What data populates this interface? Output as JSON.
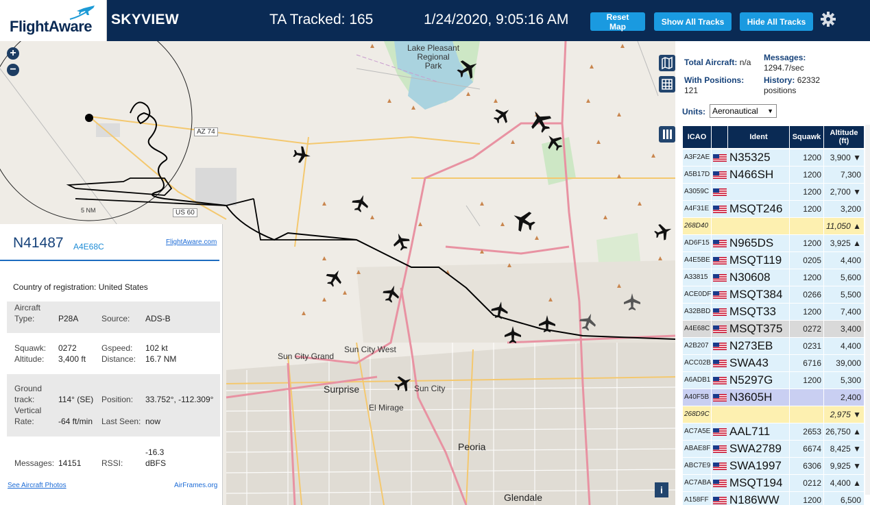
{
  "header": {
    "logo_text": "FlightAware",
    "app_title": "SKYVIEW",
    "tracked": "TA Tracked: 165",
    "timestamp": "1/24/2020, 9:05:16 AM",
    "buttons": {
      "reset": "Reset Map",
      "show_all": "Show All Tracks",
      "hide_all": "Hide All Tracks"
    }
  },
  "map": {
    "zoom_in": "+",
    "zoom_out": "−",
    "info": "i",
    "labels": {
      "lake": "Lake Pleasant Regional Park",
      "lake1": "Lake Pleasant",
      "lake2": "Regional",
      "lake3": "Park",
      "az74": "AZ 74",
      "us60": "US 60",
      "range": "5 NM",
      "sun_city_grand": "Sun City Grand",
      "sun_city_west": "Sun City West",
      "sun_city": "Sun City",
      "surprise": "Surprise",
      "el_mirage": "El Mirage",
      "peoria": "Peoria",
      "glendale": "Glendale"
    }
  },
  "detail": {
    "registration": "N41487",
    "hex": "A4E68C",
    "link": "FlightAware.com",
    "country_label": "Country of registration:",
    "country": "United States",
    "aircraft_type_label1": "Aircraft",
    "aircraft_type_label2": "Type:",
    "aircraft_type": "P28A",
    "source_label": "Source:",
    "source": "ADS-B",
    "squawk_label": "Squawk:",
    "squawk": "0272",
    "gspeed_label": "Gspeed:",
    "gspeed": "102 kt",
    "altitude_label": "Altitude:",
    "altitude": "3,400 ft",
    "distance_label": "Distance:",
    "distance": "16.7 NM",
    "track_label1": "Ground",
    "track_label2": "track:",
    "track": "114° (SE)",
    "position_label": "Position:",
    "position": "33.752°, -112.309°",
    "vrate_label1": "Vertical",
    "vrate_label2": "Rate:",
    "vrate": "-64 ft/min",
    "last_seen_label": "Last Seen:",
    "last_seen": "now",
    "messages_label": "Messages:",
    "messages": "14151",
    "rssi_label": "RSSI:",
    "rssi1": "-16.3",
    "rssi2": "dBFS",
    "photos_link": "See Aircraft Photos",
    "airframes_link": "AirFrames.org"
  },
  "stats": {
    "total_label": "Total Aircraft:",
    "total": "n/a",
    "messages_label": "Messages:",
    "messages": "1294.7/sec",
    "positions_label": "With Positions:",
    "positions": "121",
    "history_label": "History:",
    "history": "62332",
    "history_unit": "positions",
    "units_label": "Units:",
    "units_value": "Aeronautical"
  },
  "table": {
    "headers": {
      "icao": "ICAO",
      "ident": "Ident",
      "squawk": "Squawk",
      "altitude1": "Altitude",
      "altitude2": "(ft)"
    },
    "rows": [
      {
        "icao": "A3F2AE",
        "ident": "N35325",
        "squawk": "1200",
        "alt": "3,900 ▼"
      },
      {
        "icao": "A5B17D",
        "ident": "N466SH",
        "squawk": "1200",
        "alt": "7,300"
      },
      {
        "icao": "A3059C",
        "ident": "",
        "squawk": "1200",
        "alt": "2,700 ▼"
      },
      {
        "icao": "A4F31E",
        "ident": "MSQT246",
        "squawk": "1200",
        "alt": "3,200"
      },
      {
        "icao": "268D40",
        "ident": "",
        "squawk": "",
        "alt": "11,050 ▲"
      },
      {
        "icao": "AD6F15",
        "ident": "N965DS",
        "squawk": "1200",
        "alt": "3,925 ▲"
      },
      {
        "icao": "A4E5BE",
        "ident": "MSQT119",
        "squawk": "0205",
        "alt": "4,400"
      },
      {
        "icao": "A33815",
        "ident": "N30608",
        "squawk": "1200",
        "alt": "5,600"
      },
      {
        "icao": "ACE0DF",
        "ident": "MSQT384",
        "squawk": "0266",
        "alt": "5,500"
      },
      {
        "icao": "A32BBD",
        "ident": "MSQT33",
        "squawk": "1200",
        "alt": "7,400"
      },
      {
        "icao": "A4E68C",
        "ident": "MSQT375",
        "squawk": "0272",
        "alt": "3,400"
      },
      {
        "icao": "A2B207",
        "ident": "N273EB",
        "squawk": "0231",
        "alt": "4,400"
      },
      {
        "icao": "ACC02B",
        "ident": "SWA43",
        "squawk": "6716",
        "alt": "39,000"
      },
      {
        "icao": "A6ADB1",
        "ident": "N5297G",
        "squawk": "1200",
        "alt": "5,300"
      },
      {
        "icao": "A40F5B",
        "ident": "N3605H",
        "squawk": "",
        "alt": "2,400"
      },
      {
        "icao": "268D9C",
        "ident": "",
        "squawk": "",
        "alt": "2,975 ▼"
      },
      {
        "icao": "AC7A5E",
        "ident": "AAL711",
        "squawk": "2653",
        "alt": "26,750 ▲"
      },
      {
        "icao": "ABAE8F",
        "ident": "SWA2789",
        "squawk": "6674",
        "alt": "8,425 ▼"
      },
      {
        "icao": "ABC7E9",
        "ident": "SWA1997",
        "squawk": "6306",
        "alt": "9,925 ▼"
      },
      {
        "icao": "AC7ABA",
        "ident": "MSQT194",
        "squawk": "0212",
        "alt": "4,400 ▲"
      },
      {
        "icao": "A158FF",
        "ident": "N186WW",
        "squawk": "1200",
        "alt": "6,500"
      }
    ]
  }
}
